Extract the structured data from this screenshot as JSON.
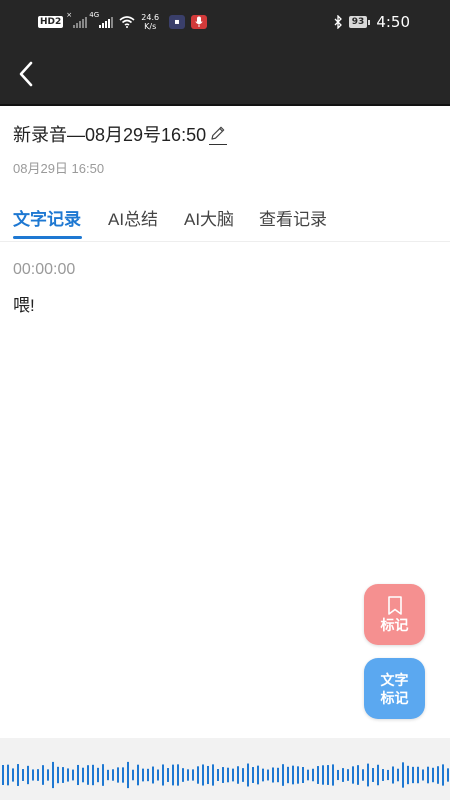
{
  "status_bar": {
    "hd": "HD",
    "hd_sub": "2",
    "signal1_tag": "×",
    "signal2_tag": "4G",
    "speed_value": "24.6",
    "speed_unit": "K/s",
    "battery": "93",
    "time": "4:50",
    "icons": [
      "hd-icon",
      "signal-icon",
      "wifi-icon",
      "app-notification-icon",
      "microphone-icon",
      "bluetooth-icon",
      "battery-icon"
    ]
  },
  "nav": {
    "back_icon": "chevron-left-icon"
  },
  "recording": {
    "title": "新录音—08月29号16:50",
    "date": "08月29日 16:50",
    "edit_icon": "pencil-icon"
  },
  "tabs": [
    {
      "label": "文字记录",
      "active": true
    },
    {
      "label": "AI总结",
      "active": false
    },
    {
      "label": "AI大脑",
      "active": false
    },
    {
      "label": "查看记录",
      "active": false
    }
  ],
  "transcript": {
    "timestamp": "00:00:00",
    "text": "喂!"
  },
  "fabs": {
    "mark_label": "标记",
    "mark_icon": "bookmark-icon",
    "text_mark_line1": "文字",
    "text_mark_line2": "标记"
  },
  "colors": {
    "accent": "#1E78D2",
    "mark_button": "#F59090",
    "text_mark_button": "#5BA8F0",
    "header_bg": "#262626",
    "waveform": "#1E78D2"
  }
}
